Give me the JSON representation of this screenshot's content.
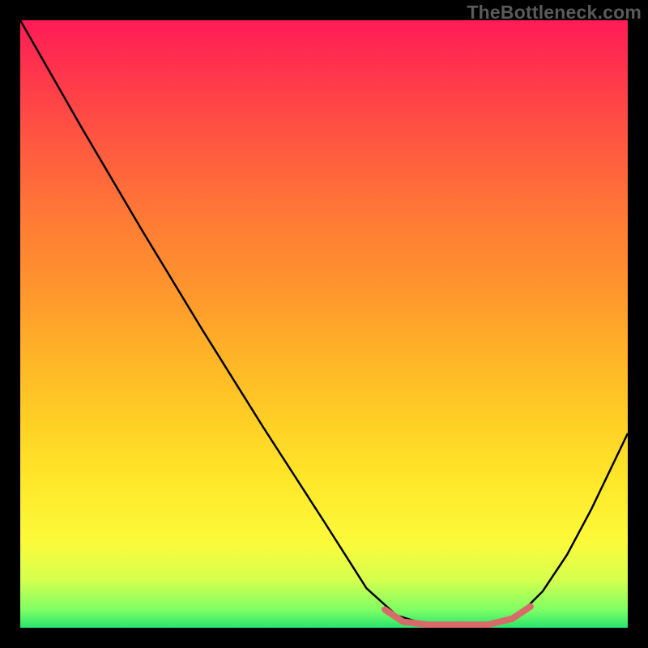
{
  "watermark": "TheBottleneck.com",
  "colors": {
    "background": "#000000",
    "curve_stroke": "#000000",
    "highlight_stroke": "#d96a6a",
    "gradient_stops": [
      "#ff1b57",
      "#ff972d",
      "#ffe82a",
      "#29e56e"
    ]
  },
  "chart_data": {
    "type": "line",
    "title": "",
    "xlabel": "",
    "ylabel": "",
    "xlim": [
      0,
      100
    ],
    "ylim": [
      0,
      100
    ],
    "grid": false,
    "legend": false,
    "series": [
      {
        "name": "bottleneck-curve",
        "x": [
          0,
          4,
          10,
          20,
          30,
          40,
          50,
          57,
          62,
          67,
          72,
          77,
          82,
          86,
          90,
          94,
          100
        ],
        "y": [
          100,
          93,
          82.5,
          65.5,
          49,
          33,
          17.5,
          6.5,
          2,
          0.5,
          0.5,
          0.5,
          2,
          6,
          12,
          19.5,
          32
        ]
      },
      {
        "name": "valley-highlight",
        "x": [
          60,
          63,
          67,
          72,
          77,
          81,
          84
        ],
        "y": [
          3,
          1,
          0.5,
          0.5,
          0.5,
          1.5,
          3.5
        ]
      }
    ]
  }
}
